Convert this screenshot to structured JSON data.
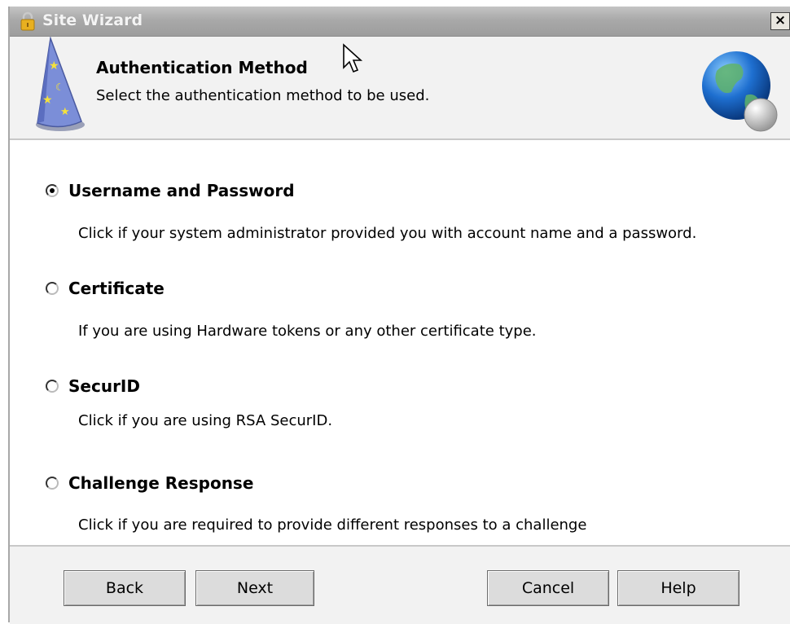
{
  "window": {
    "title": "Site Wizard",
    "close_glyph": "×"
  },
  "header": {
    "title": "Authentication Method",
    "subtitle": "Select the authentication method to be used."
  },
  "options": [
    {
      "label": "Username and Password",
      "description": "Click if your system administrator provided you with account name and a password.",
      "selected": true
    },
    {
      "label": "Certificate",
      "description": "If you are using Hardware tokens or any other certificate type.",
      "selected": false
    },
    {
      "label": "SecurID",
      "description": "Click if you are using RSA SecurID.",
      "selected": false
    },
    {
      "label": "Challenge Response",
      "description": "Click if you are required to provide different responses to a challenge",
      "selected": false
    }
  ],
  "buttons": {
    "back": "Back",
    "next": "Next",
    "cancel": "Cancel",
    "help": "Help"
  },
  "icons": {
    "title": "lock-icon",
    "header_left": "wizard-hat-icon",
    "header_right": "globe-icon"
  },
  "colors": {
    "titlebar": "#a9a9a9",
    "header_bg": "#f2f2f2",
    "lock": "#e8b020",
    "globe": "#1e6fd0",
    "hat": "#7b8ed8"
  }
}
